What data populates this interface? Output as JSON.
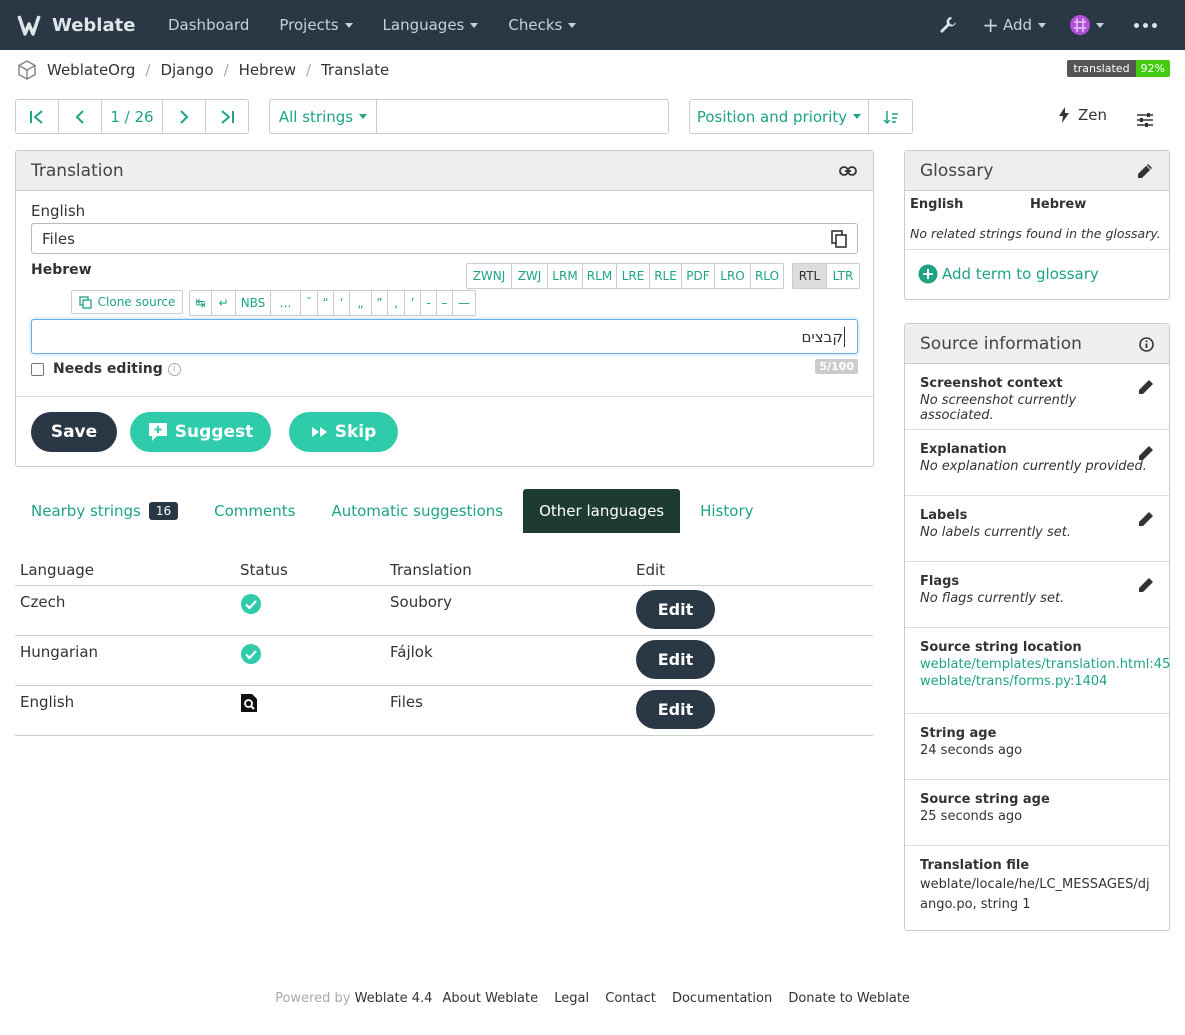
{
  "nav": {
    "brand": "Weblate",
    "items": [
      "Dashboard",
      "Projects",
      "Languages",
      "Checks"
    ],
    "add_label": "Add"
  },
  "breadcrumb": [
    "WeblateOrg",
    "Django",
    "Hebrew",
    "Translate"
  ],
  "badge": {
    "label": "translated",
    "value": "92%"
  },
  "pager": {
    "position": "1 / 26"
  },
  "filter": {
    "label": "All strings",
    "search_value": ""
  },
  "sort": {
    "label": "Position and priority"
  },
  "zen_label": "Zen",
  "translation": {
    "heading": "Translation",
    "source_lang": "English",
    "source_text": "Files",
    "target_lang": "Hebrew",
    "direction_buttons": [
      "ZWNJ",
      "ZWJ",
      "LRM",
      "RLM",
      "LRE",
      "RLE",
      "PDF",
      "LRO",
      "RLO"
    ],
    "rtl": "RTL",
    "ltr": "LTR",
    "clone_label": "Clone source",
    "special_chars": [
      "↹",
      "↵",
      "NBS",
      "…",
      "ˉ",
      "“",
      "‘",
      "„",
      "”",
      "‚",
      "’",
      "-",
      "–",
      "—"
    ],
    "target_text": "קבצים",
    "needs_editing": "Needs editing",
    "counter": "5/100",
    "save": "Save",
    "suggest": "Suggest",
    "skip": "Skip"
  },
  "tabs": [
    {
      "label": "Nearby strings",
      "count": "16"
    },
    {
      "label": "Comments"
    },
    {
      "label": "Automatic suggestions"
    },
    {
      "label": "Other languages"
    },
    {
      "label": "History"
    }
  ],
  "other_languages": {
    "headers": [
      "Language",
      "Status",
      "Translation",
      "Edit"
    ],
    "rows": [
      {
        "language": "Czech",
        "translation": "Soubory",
        "edit": "Edit"
      },
      {
        "language": "Hungarian",
        "translation": "Fájlok",
        "edit": "Edit"
      },
      {
        "language": "English",
        "translation": "Files",
        "edit": "Edit"
      }
    ]
  },
  "glossary": {
    "heading": "Glossary",
    "col1": "English",
    "col2": "Hebrew",
    "empty": "No related strings found in the glossary.",
    "add": "Add term to glossary"
  },
  "source_info": {
    "heading": "Source information",
    "rows": [
      {
        "title": "Screenshot context",
        "value": "No screenshot currently associated."
      },
      {
        "title": "Explanation",
        "value": "No explanation currently provided."
      },
      {
        "title": "Labels",
        "value": "No labels currently set."
      },
      {
        "title": "Flags",
        "value": "No flags currently set."
      }
    ],
    "location_title": "Source string location",
    "locations": [
      "weblate/templates/translation.html:45",
      "weblate/trans/forms.py:1404"
    ],
    "string_age_title": "String age",
    "string_age": "24 seconds ago",
    "source_age_title": "Source string age",
    "source_age": "25 seconds ago",
    "file_title": "Translation file",
    "file_value": "weblate/locale/he/LC_MESSAGES/django.po, string 1"
  },
  "footer": {
    "powered": "Powered by",
    "version": "Weblate 4.4",
    "links": [
      "About Weblate",
      "Legal",
      "Contact",
      "Documentation",
      "Donate to Weblate"
    ]
  },
  "colors": {
    "accent": "#1fa385",
    "navbar": "#2a3744",
    "dark_button": "#2a3744",
    "active_tab": "#1d3b32"
  }
}
